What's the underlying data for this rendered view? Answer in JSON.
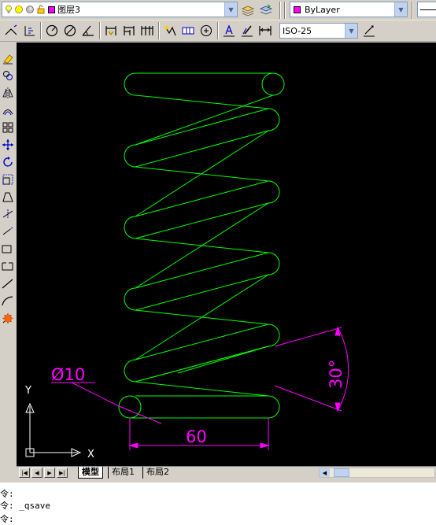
{
  "toolbar": {
    "layer_name": "图层3",
    "layer_color": "#ff00ff",
    "color_control": "ByLayer",
    "dim_style": "ISO-25"
  },
  "drawing": {
    "spring_color": "#00ff00",
    "dimension_color": "#ff00ff",
    "dim_diameter": "Ø10",
    "dim_length": "60",
    "dim_angle": "30°",
    "ucs_x": "X",
    "ucs_y": "Y"
  },
  "tabs": [
    {
      "label": "模型",
      "active": true
    },
    {
      "label": "布局1",
      "active": false
    },
    {
      "label": "布局2",
      "active": false
    }
  ],
  "command_line": [
    "令:",
    "令: _qsave",
    "令:"
  ]
}
